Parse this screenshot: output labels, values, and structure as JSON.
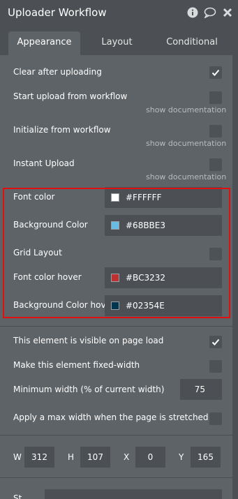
{
  "window": {
    "title": "Uploader Workflow",
    "icons": [
      "info-icon",
      "comment-icon",
      "close-icon"
    ]
  },
  "tabs": [
    {
      "label": "Appearance",
      "active": true
    },
    {
      "label": "Layout",
      "active": false
    },
    {
      "label": "Conditional",
      "active": false
    }
  ],
  "options": {
    "clear_after_uploading": {
      "label": "Clear after uploading",
      "checked": true
    },
    "start_upload": {
      "label": "Start upload from workflow",
      "checked": false,
      "doc": "show documentation"
    },
    "initialize": {
      "label": "Initialize from workflow",
      "checked": false,
      "doc": "show documentation"
    },
    "instant_upload": {
      "label": "Instant Upload",
      "checked": false,
      "doc": "show documentation"
    }
  },
  "colors": {
    "font_color": {
      "label": "Font color",
      "value": "#FFFFFF",
      "swatch": "#FFFFFF"
    },
    "background_color": {
      "label": "Background Color",
      "value": "#68BBE3",
      "swatch": "#68BBE3"
    },
    "grid_layout": {
      "label": "Grid Layout",
      "checked": false
    },
    "font_color_hover": {
      "label": "Font color hover",
      "value": "#BC3232",
      "swatch": "#BC3232"
    },
    "background_color_hover": {
      "label": "Background Color hov",
      "value": "#02354E",
      "swatch": "#02354E"
    }
  },
  "visibility": {
    "visible_on_load": {
      "label": "This element is visible on page load",
      "checked": true
    },
    "fixed_width": {
      "label": "Make this element fixed-width",
      "checked": false
    },
    "min_width": {
      "label": "Minimum width (% of current width)",
      "value": "75"
    },
    "max_width": {
      "label": "Apply a max width when the page is stretched",
      "checked": false
    }
  },
  "geometry": {
    "w": {
      "label": "W",
      "value": "312"
    },
    "h": {
      "label": "H",
      "value": "107"
    },
    "x": {
      "label": "X",
      "value": "0"
    },
    "y": {
      "label": "Y",
      "value": "165"
    }
  },
  "style": {
    "label": "St..."
  },
  "accent": "#e01010"
}
